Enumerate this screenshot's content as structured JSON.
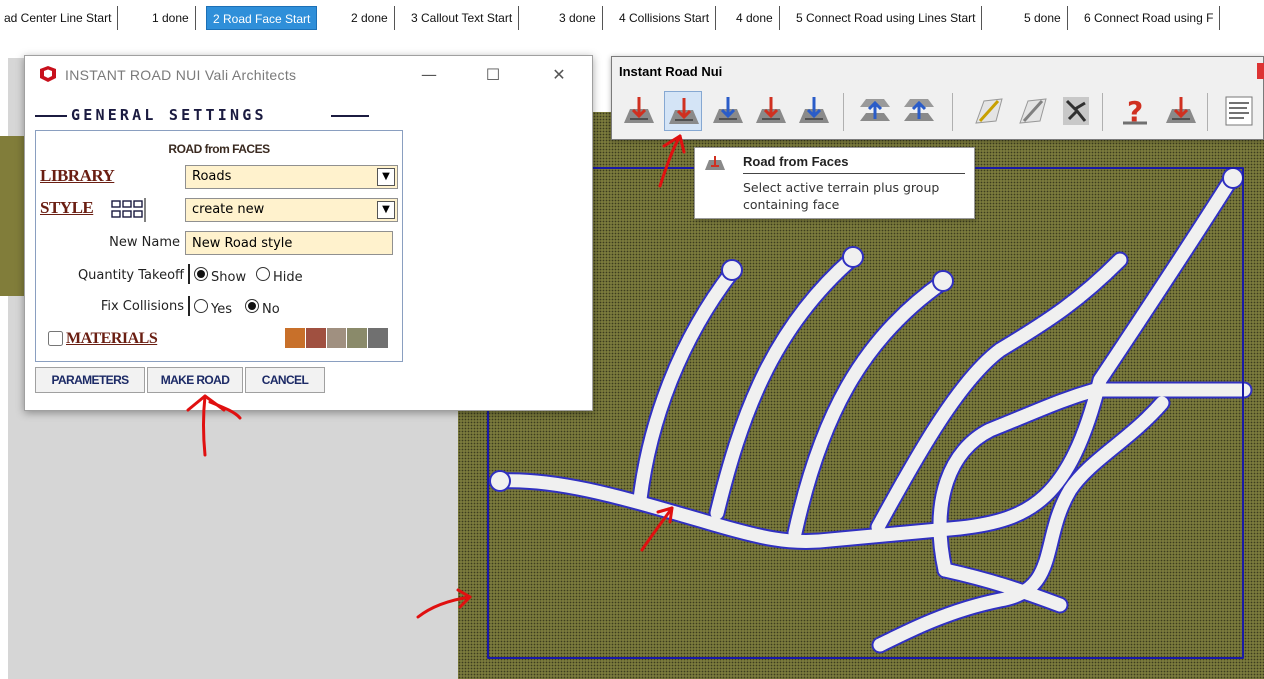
{
  "scene_tabs": [
    {
      "label": "ad Center Line Start",
      "active": false
    },
    {
      "label": "1 done",
      "active": false
    },
    {
      "label": "2 Road Face Start",
      "active": true
    },
    {
      "label": "2 done",
      "active": false
    },
    {
      "label": "3 Callout Text Start",
      "active": false
    },
    {
      "label": "3 done",
      "active": false
    },
    {
      "label": "4 Collisions Start",
      "active": false
    },
    {
      "label": "4 done",
      "active": false
    },
    {
      "label": "5 Connect Road using Lines Start",
      "active": false
    },
    {
      "label": "5 done",
      "active": false
    },
    {
      "label": "6 Connect Road using F",
      "active": false
    }
  ],
  "dialog": {
    "title": "INSTANT ROAD NUI  Vali Architects",
    "icon": "sketchup-logo-icon",
    "minimize_glyph": "—",
    "maximize_glyph": "☐",
    "close_glyph": "✕",
    "heading": "GENERAL SETTINGS",
    "section_title": "ROAD from FACES",
    "library_label": "LIBRARY",
    "library_value": "Roads",
    "style_label": "STYLE",
    "style_value": "create new",
    "new_name_label": "New Name",
    "new_name_value": "New Road style",
    "quantity_label": "Quantity Takeoff",
    "quantity_options": [
      "Show",
      "Hide"
    ],
    "quantity_selected": "Show",
    "fix_label": "Fix Collisions",
    "fix_options": [
      "Yes",
      "No"
    ],
    "fix_selected": "No",
    "materials_label": "MATERIALS",
    "materials_checked": false,
    "material_swatches": [
      "#c8702a",
      "#a05040",
      "#a09080",
      "#8a8a6a",
      "#707070"
    ],
    "buttons": {
      "parameters": "PARAMETERS",
      "make_road": "MAKE ROAD",
      "cancel": "CANCEL"
    }
  },
  "toolbar": {
    "title": "Instant Road Nui",
    "tools": [
      "road-from-center-lines-icon",
      "road-from-faces-icon",
      "road-callout-icon",
      "road-collisions-icon",
      "road-edit-icon",
      "grade-up-icon",
      "grade-down-icon",
      "connect-lines-icon",
      "connect-faces-icon",
      "road-network-icon",
      "help-icon",
      "repair-icon",
      "report-icon"
    ],
    "hovered": "road-from-faces-icon"
  },
  "tooltip": {
    "title": "Road from Faces",
    "description": "Select active terrain plus group containing face"
  },
  "colors": {
    "active_tab": "#2f8fd9",
    "terrain": "#7a7a3c",
    "road": "#f0f0f0",
    "boundary": "#1a1aa8",
    "annotation_arrow": "#e01010",
    "label_red": "#6a1e12",
    "button_text": "#1c2a66"
  }
}
